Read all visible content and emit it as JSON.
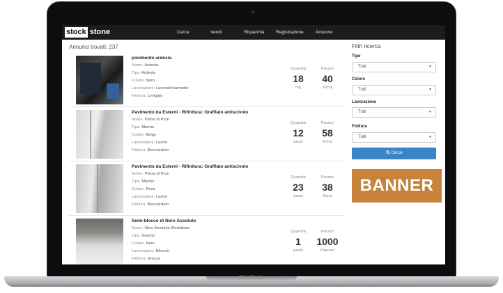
{
  "device": {
    "brand_label": "MacBook"
  },
  "navbar": {
    "logo_part1": "stock",
    "logo_part2": "stone",
    "items": [
      "Cerca",
      "Vendi",
      "Risparmia",
      "Registrazione",
      "Accesso"
    ]
  },
  "results": {
    "count_label": "Annunci trovati: 237",
    "quantity_label": "Quantità",
    "price_label": "Prezzo",
    "items": [
      {
        "title": "pavimento ardesia",
        "attributes": [
          {
            "label": "Nome:",
            "value": "Ardesia"
          },
          {
            "label": "Tipo:",
            "value": "Ardesia"
          },
          {
            "label": "Colore:",
            "value": "Nero"
          },
          {
            "label": "Lavorazione:",
            "value": "Lavorati/marmette"
          },
          {
            "label": "Finitura:",
            "value": "Levigato"
          }
        ],
        "quantity": "18",
        "quantity_unit": "mq",
        "price": "40",
        "price_unit": "€/mq"
      },
      {
        "title": "Pavimento da Esterni - Rifinitura: Graffiato antiscivolo",
        "attributes": [
          {
            "label": "Nome:",
            "value": "Pietra di Prun"
          },
          {
            "label": "Tipo:",
            "value": "Marmo"
          },
          {
            "label": "Colore:",
            "value": "Beige"
          },
          {
            "label": "Lavorazione:",
            "value": "Lastre"
          },
          {
            "label": "Finitura:",
            "value": "Bocciardato"
          }
        ],
        "quantity": "12",
        "quantity_unit": "pezzi",
        "price": "58",
        "price_unit": "€/mq"
      },
      {
        "title": "Pavimento da Esterni - Rifinitura: Graffiato antiscivolo",
        "attributes": [
          {
            "label": "Nome:",
            "value": "Pietra di Prun"
          },
          {
            "label": "Tipo:",
            "value": "Marmo"
          },
          {
            "label": "Colore:",
            "value": "Rosa"
          },
          {
            "label": "Lavorazione:",
            "value": "Lastre"
          },
          {
            "label": "Finitura:",
            "value": "Bocciardato"
          }
        ],
        "quantity": "23",
        "quantity_unit": "pezzi",
        "price": "38",
        "price_unit": "€/mq"
      },
      {
        "title": "Semi-blocco di Nero Assoluto",
        "attributes": [
          {
            "label": "Nome:",
            "value": "Nero Assoluto Zimbabwe"
          },
          {
            "label": "Tipo:",
            "value": "Granito"
          },
          {
            "label": "Colore:",
            "value": "Nero"
          },
          {
            "label": "Lavorazione:",
            "value": "Blocchi"
          },
          {
            "label": "Finitura:",
            "value": "Grezzo"
          }
        ],
        "quantity": "1",
        "quantity_unit": "pezzi",
        "price": "1000",
        "price_unit": "€/pezzo"
      }
    ]
  },
  "filters": {
    "title": "Filtri ricerca",
    "groups": [
      {
        "label": "Tipo",
        "value": "Tutti"
      },
      {
        "label": "Colore",
        "value": "Tutti"
      },
      {
        "label": "Lavorazione",
        "value": "Tutti"
      },
      {
        "label": "Finitura",
        "value": "Tutti"
      }
    ],
    "search_label": "Cerca",
    "search_icon": "search-icon"
  },
  "banner": {
    "text": "BANNER"
  },
  "colors": {
    "accent_button": "#3a84c9",
    "banner": "#c7833c",
    "navbar": "#1c1c1c"
  }
}
